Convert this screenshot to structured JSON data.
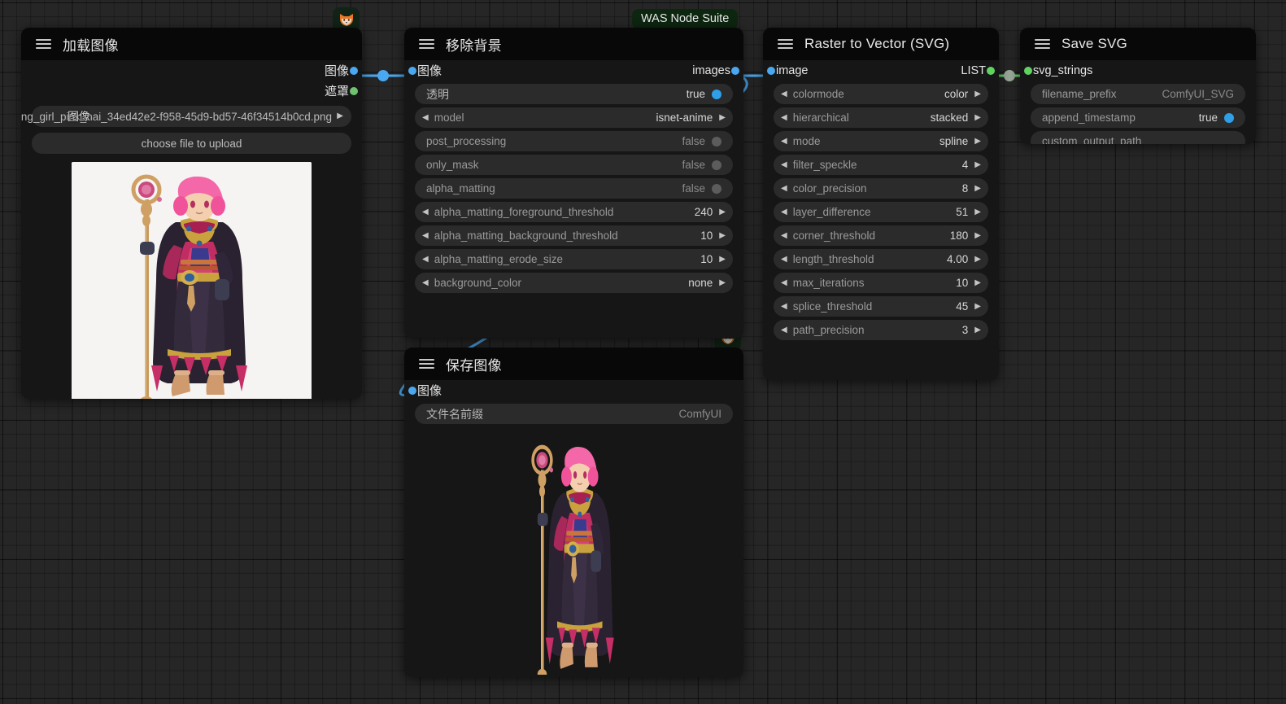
{
  "canvas": {
    "background_color": "#262626",
    "grid": true
  },
  "badges": {
    "node_suite_label": "WAS Node Suite",
    "fox_icon": "fox-emoji",
    "fox_glyph": "🦊"
  },
  "nodes": [
    {
      "id": "load-image",
      "title": "加载图像",
      "outputs": [
        {
          "name": "图像",
          "type": "IMAGE",
          "color": "#4aa8f0"
        },
        {
          "name": "遮罩",
          "type": "MASK",
          "color": "#6fc26f"
        }
      ],
      "widgets": [
        {
          "name": "image",
          "kind": "combo-file",
          "value": "ng_girl_pink_hai_34ed42e2-f958-45d9-bd57-46f34514b0cd.png",
          "overlap_label": "图像"
        },
        {
          "name": "upload",
          "kind": "button",
          "value": "choose file to upload"
        }
      ],
      "preview": {
        "kind": "image-preview",
        "background": "white",
        "alt": "pink-haired mage character with golden staff"
      }
    },
    {
      "id": "remove-background",
      "title": "移除背景",
      "inputs": [
        {
          "name": "图像",
          "type": "IMAGE",
          "color": "#4aa8f0"
        }
      ],
      "outputs": [
        {
          "name": "images",
          "type": "IMAGE",
          "color": "#4aa8f0"
        }
      ],
      "widgets": [
        {
          "name": "透明",
          "kind": "toggle",
          "value": "true",
          "state": "on"
        },
        {
          "name": "model",
          "kind": "combo",
          "value": "isnet-anime"
        },
        {
          "name": "post_processing",
          "kind": "toggle",
          "value": "false",
          "state": "off"
        },
        {
          "name": "only_mask",
          "kind": "toggle",
          "value": "false",
          "state": "off"
        },
        {
          "name": "alpha_matting",
          "kind": "toggle",
          "value": "false",
          "state": "off"
        },
        {
          "name": "alpha_matting_foreground_threshold",
          "kind": "number",
          "value": "240"
        },
        {
          "name": "alpha_matting_background_threshold",
          "kind": "number",
          "value": "10"
        },
        {
          "name": "alpha_matting_erode_size",
          "kind": "number",
          "value": "10"
        },
        {
          "name": "background_color",
          "kind": "combo",
          "value": "none"
        }
      ]
    },
    {
      "id": "raster-to-vector",
      "title": "Raster to Vector (SVG)",
      "inputs": [
        {
          "name": "image",
          "type": "IMAGE",
          "color": "#4aa8f0"
        }
      ],
      "outputs": [
        {
          "name": "LIST",
          "type": "LIST",
          "color": "#5fd35f"
        }
      ],
      "widgets": [
        {
          "name": "colormode",
          "kind": "combo",
          "value": "color"
        },
        {
          "name": "hierarchical",
          "kind": "combo",
          "value": "stacked"
        },
        {
          "name": "mode",
          "kind": "combo",
          "value": "spline"
        },
        {
          "name": "filter_speckle",
          "kind": "number",
          "value": "4"
        },
        {
          "name": "color_precision",
          "kind": "number",
          "value": "8"
        },
        {
          "name": "layer_difference",
          "kind": "number",
          "value": "51"
        },
        {
          "name": "corner_threshold",
          "kind": "number",
          "value": "180"
        },
        {
          "name": "length_threshold",
          "kind": "number",
          "value": "4.00"
        },
        {
          "name": "max_iterations",
          "kind": "number",
          "value": "10"
        },
        {
          "name": "splice_threshold",
          "kind": "number",
          "value": "45"
        },
        {
          "name": "path_precision",
          "kind": "number",
          "value": "3"
        }
      ]
    },
    {
      "id": "save-svg",
      "title": "Save SVG",
      "inputs": [
        {
          "name": "svg_strings",
          "type": "LIST",
          "color": "#5fd35f"
        }
      ],
      "widgets": [
        {
          "name": "filename_prefix",
          "kind": "text",
          "value": "ComfyUI_SVG"
        },
        {
          "name": "append_timestamp",
          "kind": "toggle",
          "value": "true",
          "state": "on"
        },
        {
          "name": "custom_output_path",
          "kind": "text",
          "value": ""
        }
      ]
    },
    {
      "id": "save-image",
      "title": "保存图像",
      "inputs": [
        {
          "name": "图像",
          "type": "IMAGE",
          "color": "#4aa8f0"
        }
      ],
      "widgets": [
        {
          "name": "文件名前缀",
          "kind": "text",
          "value": "ComfyUI"
        }
      ],
      "preview": {
        "kind": "image-preview",
        "background": "transparent",
        "alt": "pink-haired mage character on transparent background"
      }
    }
  ],
  "links": [
    {
      "from": "load-image.图像",
      "to": "remove-background.图像",
      "color": "#4aa8f0"
    },
    {
      "from": "remove-background.images",
      "to": "raster-to-vector.image",
      "color": "#4aa8f0"
    },
    {
      "from": "remove-background.images",
      "to": "save-image.图像",
      "color": "#4aa8f0"
    },
    {
      "from": "raster-to-vector.LIST",
      "to": "save-svg.svg_strings",
      "color": "#5fd35f"
    }
  ]
}
